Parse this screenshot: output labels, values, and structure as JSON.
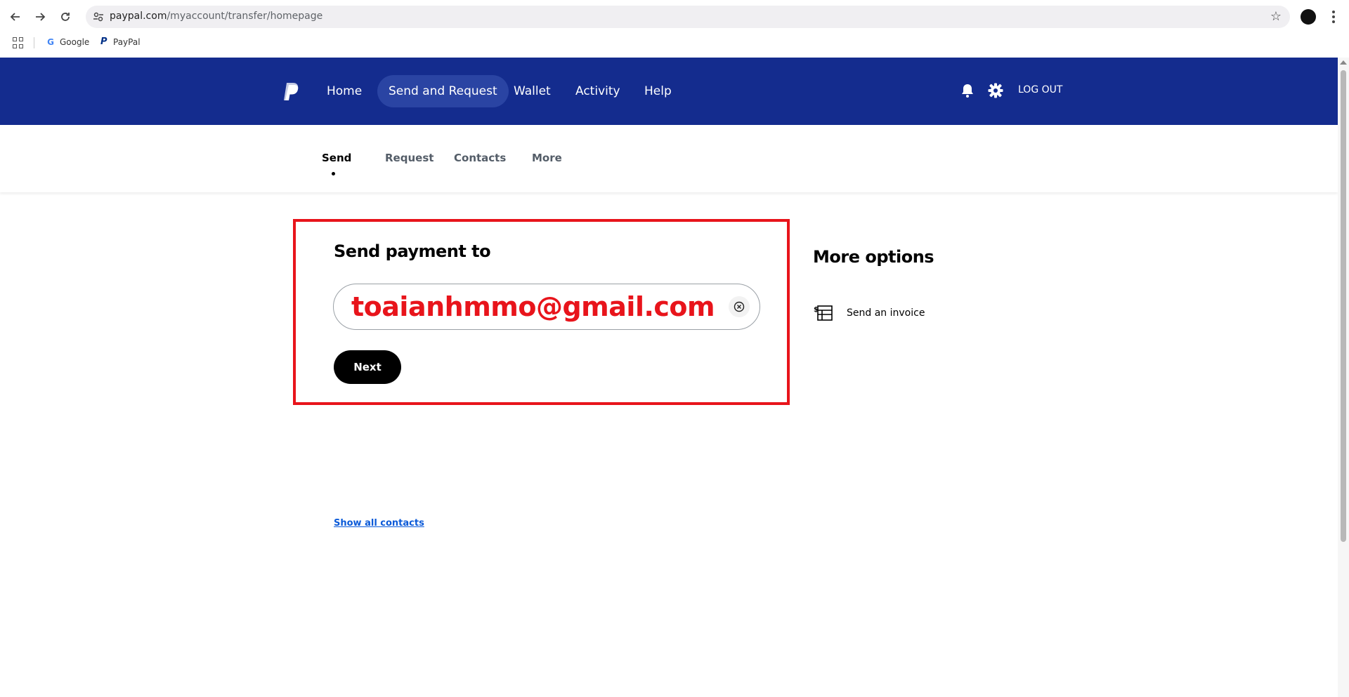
{
  "browser": {
    "url_host": "paypal.com",
    "url_path": "/myaccount/transfer/homepage",
    "bookmarks": [
      {
        "label": "Google"
      },
      {
        "label": "PayPal"
      }
    ]
  },
  "header": {
    "nav": [
      {
        "label": "Home",
        "active": false
      },
      {
        "label": "Send and Request",
        "active": true
      },
      {
        "label": "Wallet",
        "active": false
      },
      {
        "label": "Activity",
        "active": false
      },
      {
        "label": "Help",
        "active": false
      }
    ],
    "logout_label": "LOG OUT",
    "icons": [
      "bell-icon",
      "gear-icon"
    ]
  },
  "subnav": {
    "tabs": [
      {
        "label": "Send",
        "active": true
      },
      {
        "label": "Request",
        "active": false
      },
      {
        "label": "Contacts",
        "active": false
      },
      {
        "label": "More",
        "active": false
      }
    ]
  },
  "send": {
    "title": "Send payment to",
    "recipient_value": "toaianhmmo@gmail.com",
    "next_label": "Next"
  },
  "more_options": {
    "title": "More options",
    "items": [
      {
        "label": "Send an invoice",
        "icon": "invoice-icon"
      }
    ]
  },
  "contacts_link": "Show all contacts",
  "colors": {
    "header_bg": "#142c8e",
    "active_nav_bg": "#2a44a3",
    "highlight": "#e8141b",
    "link": "#0b5ad8"
  }
}
